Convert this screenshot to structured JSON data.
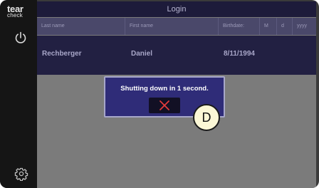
{
  "brand": {
    "line1": "tear",
    "line2": "check"
  },
  "window": {
    "title": "Login"
  },
  "table": {
    "columns": [
      "Last name",
      "First name",
      "Birthdate:",
      "M",
      "d",
      "yyyy"
    ],
    "row": {
      "last_name": "Rechberger",
      "first_name": "Daniel",
      "birthdate": "8/11/1994"
    }
  },
  "dialog": {
    "message": "Shutting down in 1 second."
  },
  "annotation": {
    "label": "D"
  },
  "colors": {
    "close_x": "#e23b3b",
    "dialog_bg": "#2f2c78",
    "header_bg": "#1d1b3a"
  },
  "icons": {
    "power": "power-icon",
    "settings": "gear-icon",
    "close": "close-icon"
  }
}
